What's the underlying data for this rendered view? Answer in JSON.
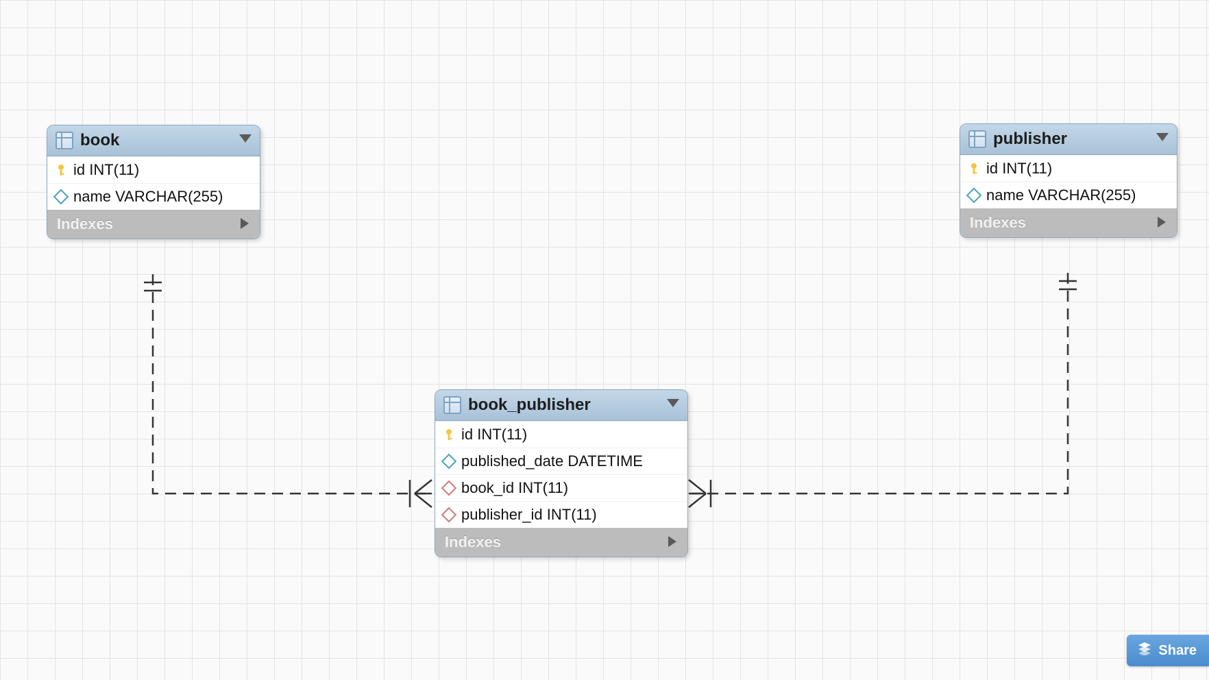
{
  "tables": {
    "book": {
      "name": "book",
      "columns": [
        {
          "label": "id INT(11)",
          "icon": "pk"
        },
        {
          "label": "name VARCHAR(255)",
          "icon": "col"
        }
      ],
      "indexes_label": "Indexes"
    },
    "publisher": {
      "name": "publisher",
      "columns": [
        {
          "label": "id INT(11)",
          "icon": "pk"
        },
        {
          "label": "name VARCHAR(255)",
          "icon": "col"
        }
      ],
      "indexes_label": "Indexes"
    },
    "book_publisher": {
      "name": "book_publisher",
      "columns": [
        {
          "label": "id INT(11)",
          "icon": "pk"
        },
        {
          "label": "published_date DATETIME",
          "icon": "col"
        },
        {
          "label": "book_id INT(11)",
          "icon": "fk"
        },
        {
          "label": "publisher_id INT(11)",
          "icon": "fk"
        }
      ],
      "indexes_label": "Indexes"
    }
  },
  "share_button": "Share",
  "relationships": [
    {
      "from": "book",
      "to": "book_publisher",
      "type": "one-to-many"
    },
    {
      "from": "publisher",
      "to": "book_publisher",
      "type": "one-to-many"
    }
  ]
}
